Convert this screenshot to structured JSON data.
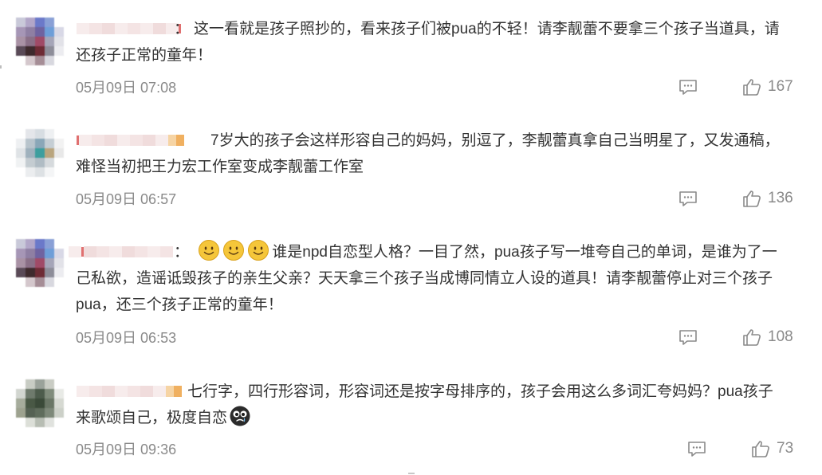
{
  "comments": [
    {
      "username": "",
      "text_lines": [
        "这一看就是孩子照抄的，看来孩子们被pua的不轻！请李靓蕾不要拿三个孩子当道具，请",
        "还孩子正常的童年！"
      ],
      "colon": "：",
      "time": "05月09日 07:08",
      "likes": "167",
      "emojis_lead": [],
      "emoji_tail": null
    },
    {
      "username": "",
      "text_lines": [
        "7岁大的孩子会这样形容自己的妈妈，别逗了，李靓蕾真拿自己当明星了，又发通稿，",
        "难怪当初把王力宏工作室变成李靓蕾工作室"
      ],
      "colon": "",
      "time": "05月09日 06:57",
      "likes": "136",
      "emojis_lead": [],
      "emoji_tail": null
    },
    {
      "username": "",
      "text_lines": [
        "谁是npd自恋型人格？一目了然，pua孩子写一堆夸自己的单词，是谁为了一",
        "己私欲，造谣诋毁孩子的亲生父亲？天天拿三个孩子当成博同情立人设的道具！请李靓蕾停止对三个孩子",
        "pua，还三个孩子正常的童年！"
      ],
      "colon": "：",
      "time": "05月09日 06:53",
      "likes": "108",
      "emojis_lead": [
        "smile-emoji",
        "smile-emoji",
        "smile-emoji"
      ],
      "emoji_tail": null
    },
    {
      "username": "",
      "text_lines": [
        "七行字，四行形容词，形容词还是按字母排序的，孩子会用这么多词汇夸妈妈？pua孩子",
        "来歌颂自己，极度自恋"
      ],
      "colon": "",
      "time": "05月09日 09:36",
      "likes": "73",
      "emojis_lead": [],
      "emoji_tail": "crying-emoji"
    }
  ],
  "icons": {
    "reply": "comment-bubble-icon",
    "like": "thumbs-up-icon"
  },
  "colors": {
    "text": "#333333",
    "meta": "#8a8a8a",
    "emoji_face": "#f5c63a"
  }
}
